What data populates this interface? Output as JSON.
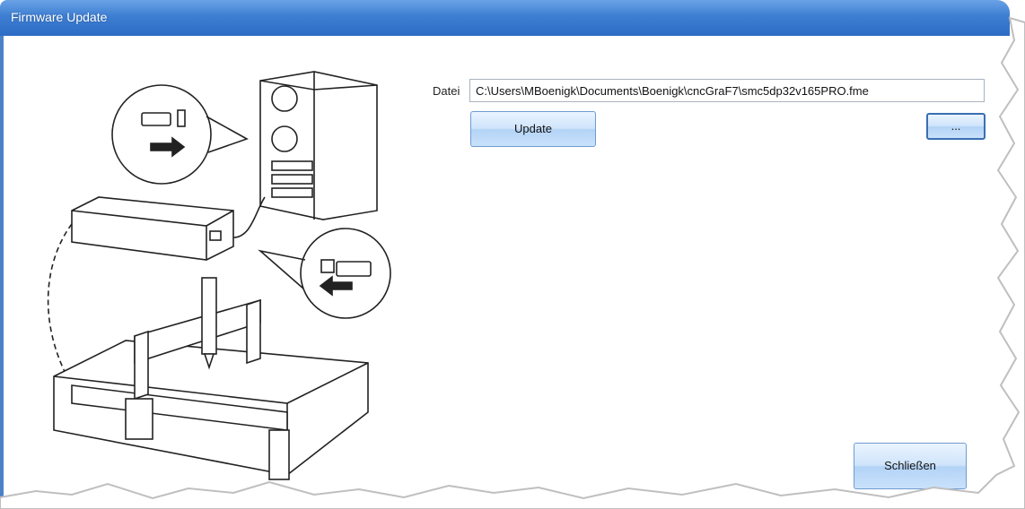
{
  "window": {
    "title": "Firmware Update"
  },
  "form": {
    "file_label": "Datei",
    "file_path": "C:\\Users\\MBoenigk\\Documents\\Boenigk\\cncGraF7\\smc5dp32v165PRO.fme",
    "update_label": "Update",
    "browse_label": "...",
    "close_label": "Schließen"
  },
  "colors": {
    "titlebar": "#3d7ed2",
    "button_face": "#cfe4fb",
    "button_border": "#6f9bd1"
  },
  "icons": [
    "cnc-machine-connection-illustration"
  ]
}
